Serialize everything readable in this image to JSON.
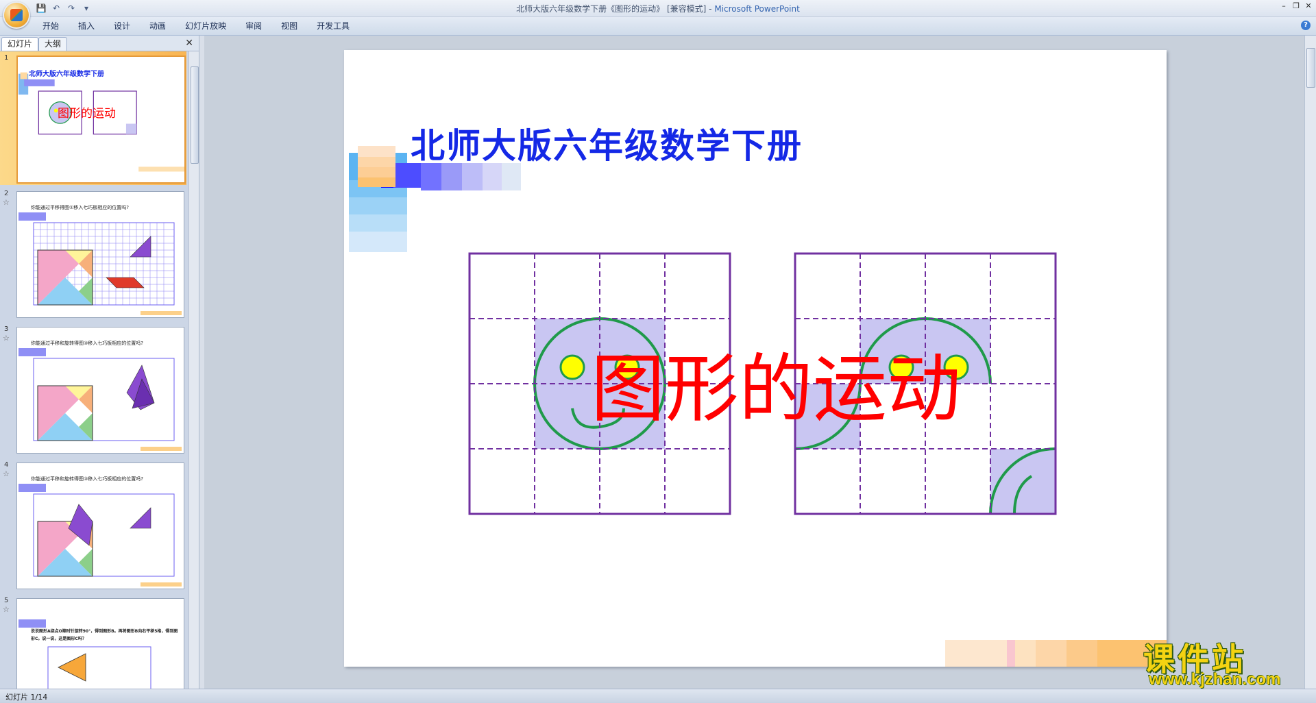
{
  "window": {
    "title_doc": "北师大版六年级数学下册《图形的运动》 [兼容模式] - ",
    "title_app": "Microsoft PowerPoint",
    "controls": [
      "–",
      "❐",
      "✕"
    ]
  },
  "qat": {
    "save": "💾",
    "undo": "↶",
    "redo": "↷",
    "more": "▾"
  },
  "ribbon": {
    "tabs": [
      "开始",
      "插入",
      "设计",
      "动画",
      "幻灯片放映",
      "审阅",
      "视图",
      "开发工具"
    ],
    "help": "?"
  },
  "pane": {
    "tab_slides": "幻灯片",
    "tab_outline": "大纲",
    "close": "✕",
    "thumbs": [
      {
        "num": "1",
        "star": "",
        "title": "北师大版六年级数学下册",
        "overlay": "图形的运动"
      },
      {
        "num": "2",
        "star": "☆",
        "caption": "你能通过平移得图①移入七巧板相应的位置吗?"
      },
      {
        "num": "3",
        "star": "☆",
        "caption": "你能通过平移和旋转得图③移入七巧板相应的位置吗?"
      },
      {
        "num": "4",
        "star": "☆",
        "caption": "你能通过平移和旋转得图③移入七巧板相应的位置吗?"
      },
      {
        "num": "5",
        "star": "☆",
        "caption": "说说图形A绕点O顺时针旋转90°，得到图形B。再将图形B向右平移5格，得到图形C。说一说，这是图形C吗？"
      }
    ]
  },
  "slide": {
    "title": "北师大版六年级数学下册",
    "overlay_text": "图形的运动"
  },
  "status": {
    "text": "幻灯片 1/14"
  },
  "watermark": {
    "cn": "课件站",
    "url": "www.kjzhan.com"
  },
  "colors": {
    "title_blue": "#1428e6",
    "overlay_red": "#ff0000",
    "grid_purple": "#7030a0",
    "shade": "#c9c6f2",
    "arc_green": "#1f9a4a",
    "eye_yellow": "#ffff00"
  }
}
